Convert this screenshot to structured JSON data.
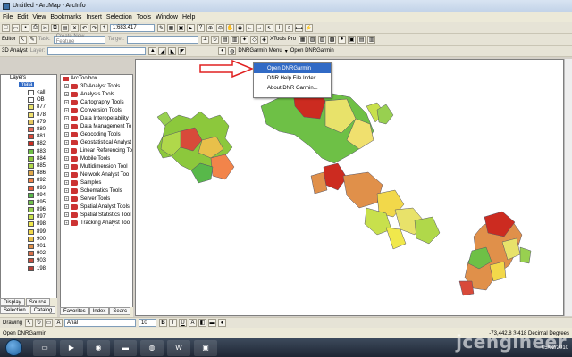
{
  "window": {
    "title": "Untitled - ArcMap - ArcInfo"
  },
  "menubar": [
    "File",
    "Edit",
    "View",
    "Bookmarks",
    "Insert",
    "Selection",
    "Tools",
    "Window",
    "Help"
  ],
  "toolbar1": {
    "scale": "1:683,417"
  },
  "toolbar2": {
    "editor_label": "Editor",
    "task_label": "Task:",
    "task_value": "Create New Feature",
    "target_label": "Target:",
    "xtools_label": "XTools Pro"
  },
  "toolbar3": {
    "analyst_label": "3D Analyst",
    "layer_label": "Layer:",
    "dnrgarmin_menu": "DNRGarmin Menu",
    "open_dnrgarmin": "Open DNRGarmin"
  },
  "dropdown": {
    "items": [
      "Open DNRGarmin",
      "DNR Help File Index...",
      "About DNR Garmin..."
    ]
  },
  "layers": {
    "root": "Layers",
    "layer": "mata",
    "items": [
      {
        "label": "<all",
        "color": "#ffffff"
      },
      {
        "label": "OB",
        "color": "#ffffff"
      },
      {
        "label": "877",
        "color": "#e8e26a"
      },
      {
        "label": "878",
        "color": "#f0e06e"
      },
      {
        "label": "879",
        "color": "#e6c860"
      },
      {
        "label": "880",
        "color": "#e86c5c"
      },
      {
        "label": "881",
        "color": "#d84a3a"
      },
      {
        "label": "882",
        "color": "#cc2b20"
      },
      {
        "label": "883",
        "color": "#6ec046"
      },
      {
        "label": "884",
        "color": "#8cc83c"
      },
      {
        "label": "885",
        "color": "#b0d84a"
      },
      {
        "label": "886",
        "color": "#e0a84a"
      },
      {
        "label": "892",
        "color": "#f2844a"
      },
      {
        "label": "893",
        "color": "#e85c3c"
      },
      {
        "label": "894",
        "color": "#58b84a"
      },
      {
        "label": "895",
        "color": "#70c04c"
      },
      {
        "label": "896",
        "color": "#98d050"
      },
      {
        "label": "897",
        "color": "#c8e04c"
      },
      {
        "label": "898",
        "color": "#f0e84c"
      },
      {
        "label": "899",
        "color": "#f2d84a"
      },
      {
        "label": "900",
        "color": "#e8c04a"
      },
      {
        "label": "901",
        "color": "#e0904a"
      },
      {
        "label": "902",
        "color": "#d8704a"
      },
      {
        "label": "903",
        "color": "#c85040"
      },
      {
        "label": "198",
        "color": "#b84038"
      }
    ],
    "tabs": [
      "Display",
      "Source",
      "Selection",
      "Catalog"
    ]
  },
  "toolbox": {
    "root": "ArcToolbox",
    "items": [
      "3D Analyst Tools",
      "Analysis Tools",
      "Cartography Tools",
      "Conversion Tools",
      "Data Interoperability",
      "Data Management To",
      "Geocoding Tools",
      "Geostatistical Analyst",
      "Linear Referencing To",
      "Mobile Tools",
      "Multidimension Tool",
      "Network Analyst Too",
      "Samples",
      "Schematics Tools",
      "Server Tools",
      "Spatial Analyst Tools",
      "Spatial Statistics Tool",
      "Tracking Analyst Too"
    ],
    "tabs": [
      "Favorites",
      "Index",
      "Searc"
    ]
  },
  "drawing": {
    "label": "Drawing",
    "font": "Arial",
    "size": "10"
  },
  "status": {
    "left": "Open DNRGarmin",
    "right": "-73,442.8  3,418  Decimal Degrees"
  },
  "taskbar": {
    "date": "05/02/2010"
  },
  "watermark": "jcengineer"
}
